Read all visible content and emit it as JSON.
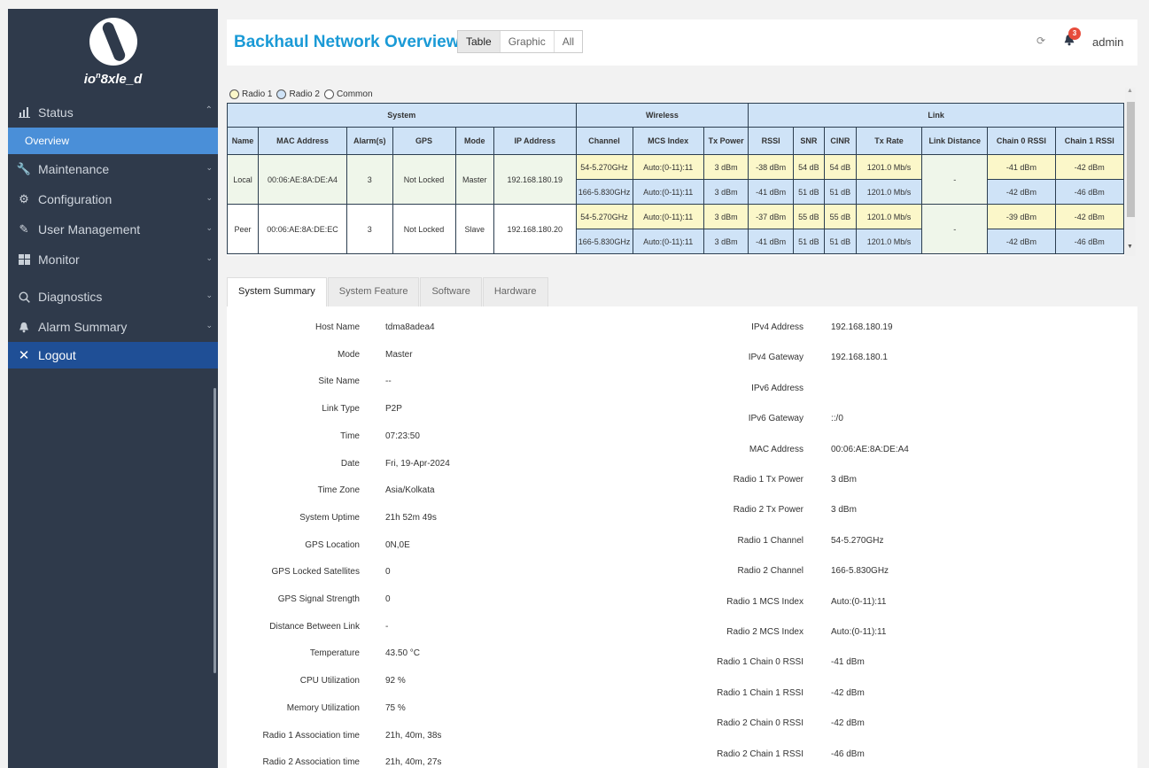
{
  "app": {
    "logo_text": "io",
    "logo_sup": "n",
    "logo_suffix": "8xle_d"
  },
  "sidebar": {
    "items": [
      {
        "label": "Status",
        "icon": "bar-chart-icon"
      },
      {
        "label": "Overview"
      },
      {
        "label": "Maintenance",
        "icon": "wrench-icon"
      },
      {
        "label": "Configuration",
        "icon": "gear-icon"
      },
      {
        "label": "User Management",
        "icon": "pencil-icon"
      },
      {
        "label": "Monitor",
        "icon": "dashboard-icon"
      },
      {
        "label": "Diagnostics",
        "icon": "search-icon"
      },
      {
        "label": "Alarm Summary",
        "icon": "bell-icon"
      },
      {
        "label": "Logout",
        "icon": "close-icon"
      }
    ]
  },
  "header": {
    "title": "Backhaul Network Overview",
    "view_tabs": [
      "Table",
      "Graphic",
      "All"
    ],
    "notification_count": "3",
    "user": "admin"
  },
  "legend": {
    "radio1": "Radio 1",
    "radio2": "Radio 2",
    "common": "Common"
  },
  "network_table": {
    "groups": [
      "System",
      "Wireless",
      "Link"
    ],
    "columns": [
      "Name",
      "MAC Address",
      "Alarm(s)",
      "GPS",
      "Mode",
      "IP Address",
      "Channel",
      "MCS Index",
      "Tx Power",
      "RSSI",
      "SNR",
      "CINR",
      "Tx Rate",
      "Link Distance",
      "Chain 0 RSSI",
      "Chain 1 RSSI"
    ],
    "rows": [
      {
        "name": "Local",
        "mac": "00:06:AE:8A:DE:A4",
        "alarms": "3",
        "gps": "Not Locked",
        "mode": "Master",
        "ip": "192.168.180.19",
        "link_distance": "-",
        "radios": [
          {
            "channel": "54-5.270GHz",
            "mcs": "Auto:(0-11):11",
            "tx_power": "3 dBm",
            "rssi": "-38 dBm",
            "snr": "54 dB",
            "cinr": "54 dB",
            "tx_rate": "1201.0 Mb/s",
            "chain0": "-41 dBm",
            "chain1": "-42 dBm"
          },
          {
            "channel": "166-5.830GHz",
            "mcs": "Auto:(0-11):11",
            "tx_power": "3 dBm",
            "rssi": "-41 dBm",
            "snr": "51 dB",
            "cinr": "51 dB",
            "tx_rate": "1201.0 Mb/s",
            "chain0": "-42 dBm",
            "chain1": "-46 dBm"
          }
        ]
      },
      {
        "name": "Peer",
        "mac": "00:06:AE:8A:DE:EC",
        "alarms": "3",
        "gps": "Not Locked",
        "mode": "Slave",
        "ip": "192.168.180.20",
        "link_distance": "-",
        "radios": [
          {
            "channel": "54-5.270GHz",
            "mcs": "Auto:(0-11):11",
            "tx_power": "3 dBm",
            "rssi": "-37 dBm",
            "snr": "55 dB",
            "cinr": "55 dB",
            "tx_rate": "1201.0 Mb/s",
            "chain0": "-39 dBm",
            "chain1": "-42 dBm"
          },
          {
            "channel": "166-5.830GHz",
            "mcs": "Auto:(0-11):11",
            "tx_power": "3 dBm",
            "rssi": "-41 dBm",
            "snr": "51 dB",
            "cinr": "51 dB",
            "tx_rate": "1201.0 Mb/s",
            "chain0": "-42 dBm",
            "chain1": "-46 dBm"
          }
        ]
      }
    ]
  },
  "info_tabs": [
    "System Summary",
    "System Feature",
    "Software",
    "Hardware"
  ],
  "summary_left": [
    {
      "label": "Host Name",
      "value": "tdma8adea4"
    },
    {
      "label": "Mode",
      "value": "Master"
    },
    {
      "label": "Site Name",
      "value": "--"
    },
    {
      "label": "Link Type",
      "value": "P2P"
    },
    {
      "label": "Time",
      "value": "07:23:50"
    },
    {
      "label": "Date",
      "value": "Fri, 19-Apr-2024"
    },
    {
      "label": "Time Zone",
      "value": "Asia/Kolkata"
    },
    {
      "label": "System Uptime",
      "value": "21h 52m 49s"
    },
    {
      "label": "GPS Location",
      "value": "0N,0E"
    },
    {
      "label": "GPS Locked Satellites",
      "value": "0"
    },
    {
      "label": "GPS Signal Strength",
      "value": "0"
    },
    {
      "label": "Distance Between Link",
      "value": "-"
    },
    {
      "label": "Temperature",
      "value": "43.50 °C"
    },
    {
      "label": "CPU Utilization",
      "value": "92 %"
    },
    {
      "label": "Memory Utilization",
      "value": "75 %"
    },
    {
      "label": "Radio 1 Association time",
      "value": "21h, 40m, 38s"
    },
    {
      "label": "Radio 2 Association time",
      "value": "21h, 40m, 27s"
    }
  ],
  "summary_right": [
    {
      "label": "IPv4 Address",
      "value": "192.168.180.19"
    },
    {
      "label": "IPv4 Gateway",
      "value": "192.168.180.1"
    },
    {
      "label": "IPv6 Address",
      "value": ""
    },
    {
      "label": "IPv6 Gateway",
      "value": "::/0"
    },
    {
      "label": "MAC Address",
      "value": "00:06:AE:8A:DE:A4"
    },
    {
      "label": "Radio 1 Tx Power",
      "value": "3 dBm"
    },
    {
      "label": "Radio 2 Tx Power",
      "value": "3 dBm"
    },
    {
      "label": "Radio 1 Channel",
      "value": "54-5.270GHz"
    },
    {
      "label": "Radio 2 Channel",
      "value": "166-5.830GHz"
    },
    {
      "label": "Radio 1 MCS Index",
      "value": "Auto:(0-11):11"
    },
    {
      "label": "Radio 2 MCS Index",
      "value": "Auto:(0-11):11"
    },
    {
      "label": "Radio 1 Chain 0 RSSI",
      "value": "-41 dBm"
    },
    {
      "label": "Radio 1 Chain 1 RSSI",
      "value": "-42 dBm"
    },
    {
      "label": "Radio 2 Chain 0 RSSI",
      "value": "-42 dBm"
    },
    {
      "label": "Radio 2 Chain 1 RSSI",
      "value": "-46 dBm"
    }
  ],
  "colors": {
    "title": "#1a9ad6",
    "sidebar_bg": "#2f3a4b",
    "active_nav": "#4a8fd8",
    "logout_bg": "#1f4f96",
    "radio1_cell": "#fbf7c9",
    "radio2_cell": "#cfe3f7",
    "badge": "#e74c3c"
  }
}
